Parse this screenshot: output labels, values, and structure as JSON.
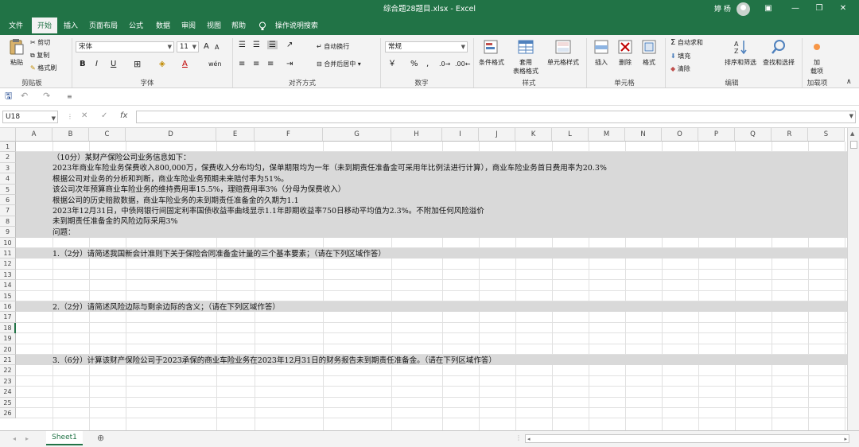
{
  "window": {
    "title": "综合题28题目.xlsx - Excel",
    "user": "婷 杨",
    "minimize": "—",
    "maximize": "❐",
    "close": "✕",
    "display_options": "▣"
  },
  "tabs": [
    "文件",
    "开始",
    "插入",
    "页面布局",
    "公式",
    "数据",
    "审阅",
    "视图",
    "帮助"
  ],
  "tell_me": "操作说明搜索",
  "ribbon": {
    "clipboard": {
      "label": "剪贴板",
      "paste": "粘贴",
      "cut": "剪切",
      "copy": "复制",
      "format_painter": "格式刷"
    },
    "font": {
      "label": "字体",
      "name": "宋体",
      "size": "11",
      "bold": "B",
      "italic": "I",
      "underline": "U",
      "grow": "A",
      "shrink": "A",
      "wen": "wén",
      "color_a": "A"
    },
    "alignment": {
      "label": "对齐方式",
      "wrap": "自动换行",
      "merge": "合并后居中"
    },
    "number": {
      "label": "数字",
      "format": "常规",
      "percent": "%",
      "comma": ","
    },
    "styles": {
      "label": "样式",
      "conditional": "条件格式",
      "table_line1": "套用",
      "table_line2": "表格格式",
      "cell_styles": "单元格样式"
    },
    "cells": {
      "label": "单元格",
      "insert": "插入",
      "delete": "删除",
      "format": "格式"
    },
    "editing": {
      "label": "编辑",
      "autosum": "自动求和",
      "fill": "填充",
      "clear": "清除",
      "sort": "排序和筛选",
      "find": "查找和选择"
    },
    "addins": {
      "label": "加载项",
      "btn_line1": "加",
      "btn_line2": "载项"
    }
  },
  "formula_bar": {
    "name_box": "U18",
    "cancel": "✕",
    "enter": "✓",
    "fx": "fx",
    "value": ""
  },
  "columns": [
    "A",
    "B",
    "C",
    "D",
    "E",
    "F",
    "G",
    "H",
    "I",
    "J",
    "K",
    "L",
    "M",
    "N",
    "O",
    "P",
    "Q",
    "R",
    "S"
  ],
  "rows": [
    "1",
    "2",
    "3",
    "4",
    "5",
    "6",
    "7",
    "8",
    "9",
    "10",
    "11",
    "12",
    "13",
    "14",
    "15",
    "16",
    "17",
    "18",
    "19",
    "20",
    "21",
    "22",
    "23",
    "24",
    "25",
    "26"
  ],
  "cells": {
    "r2": "（10分）某财产保险公司业务信息如下：",
    "r3": "2023年商业车险业务保费收入800,000万，保费收入分布均匀，保单期限均为一年（未到期责任准备金可采用年比例法进行计算），商业车险业务首日费用率为20.3%",
    "r4": "根据公司对业务的分析和判断，商业车险业务预期未来赔付率为51%。",
    "r5": "该公司次年预算商业车险业务的维持费用率15.5%，理赔费用率3%（分母为保费收入）",
    "r6": "根据公司的历史赔款数据，商业车险业务的未到期责任准备金的久期为1.1",
    "r7": "2023年12月31日，中债网银行间固定利率国债收益率曲线显示1.1年即期收益率750日移动平均值为2.3%。不附加任何风险溢价",
    "r8": "未到期责任准备金的风险边际采用3%",
    "r9": "问题：",
    "r11": "1.（2分）请简述我国新会计准则下关于保险合同准备金计量的三个基本要素；（请在下列区域作答）",
    "r16": "2.（2分）请简述风险边际与剩余边际的含义；（请在下列区域作答）",
    "r21": "3.（6分）计算该财产保险公司于2023承保的商业车险业务在2023年12月31日的财务报告未到期责任准备金。（请在下列区域作答）"
  },
  "sheet": {
    "name": "Sheet1",
    "add": "⊕"
  },
  "colors": {
    "brand": "#217346",
    "highlight": "#d9d9d9"
  }
}
